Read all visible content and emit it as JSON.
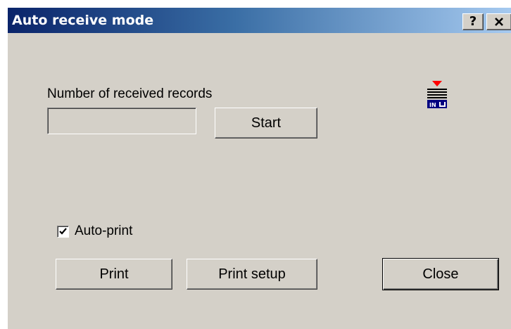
{
  "window": {
    "title": "Auto receive mode",
    "help_label": "?",
    "close_label": "✕"
  },
  "records": {
    "label": "Number of received records",
    "value": "",
    "placeholder": ""
  },
  "buttons": {
    "start": "Start",
    "print": "Print",
    "print_setup": "Print setup",
    "close": "Close"
  },
  "auto_print": {
    "label": "Auto-print",
    "checked": true
  },
  "icon": {
    "name": "receive-in-icon",
    "text": "IN",
    "arrow_color": "#ff0000",
    "base_color": "#000080"
  },
  "colors": {
    "title_start": "#0a246a",
    "title_end": "#a6caf0",
    "face": "#d4d0c8"
  }
}
